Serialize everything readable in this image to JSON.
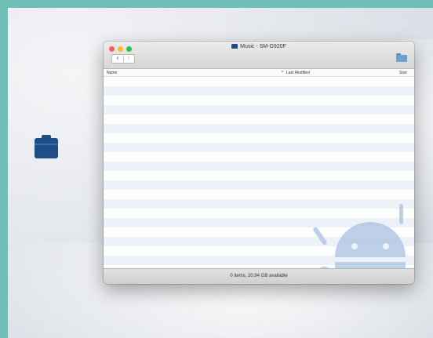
{
  "window": {
    "title": "Music - SM-G920F",
    "back_glyph": "‹",
    "forward_glyph": "›"
  },
  "columns": {
    "name": "Name",
    "last_modified": "Last Modified",
    "size": "Size",
    "sort_indicator": "^"
  },
  "status": {
    "text": "0 items, 20.94 GB available"
  },
  "colors": {
    "folder_blue": "#1f4e87",
    "row_stripe": "#edf2f8",
    "watermark": "#b7cbe6",
    "traffic_red": "#fc5d57",
    "traffic_yellow": "#fdbc2e",
    "traffic_green": "#29c840"
  },
  "icons": [
    "device-folder-icon",
    "title-folder-icon",
    "new-folder-icon",
    "android-watermark-icon"
  ]
}
